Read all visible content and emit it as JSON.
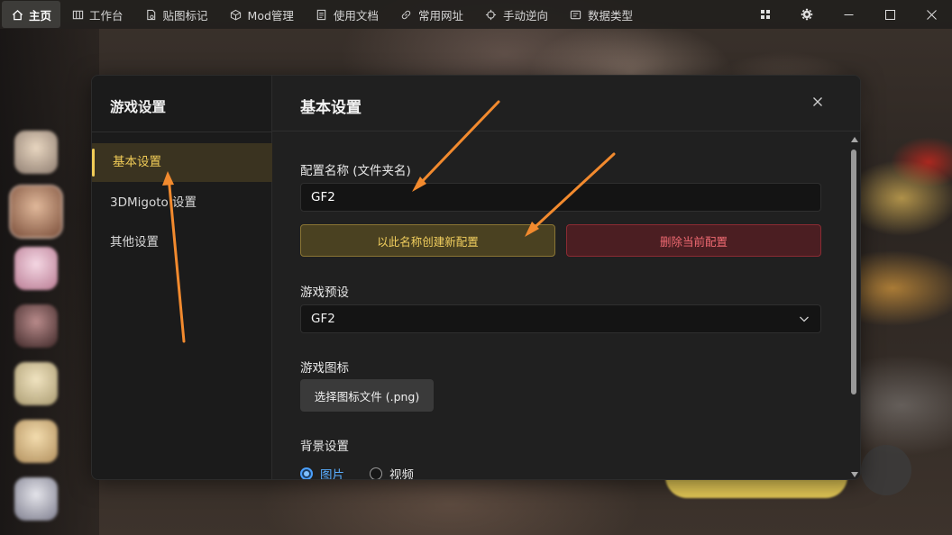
{
  "topbar": {
    "nav": [
      {
        "label": "主页",
        "icon": "home-icon",
        "active": true
      },
      {
        "label": "工作台",
        "icon": "workbench-icon"
      },
      {
        "label": "贴图标记",
        "icon": "texture-mark-icon"
      },
      {
        "label": "Mod管理",
        "icon": "cube-icon"
      },
      {
        "label": "使用文档",
        "icon": "document-icon"
      },
      {
        "label": "常用网址",
        "icon": "link-icon"
      },
      {
        "label": "手动逆向",
        "icon": "crosshair-icon"
      },
      {
        "label": "数据类型",
        "icon": "data-type-icon"
      }
    ],
    "window_buttons": [
      "grid-icon",
      "settings-icon",
      "minimize-icon",
      "maximize-icon",
      "close-icon"
    ]
  },
  "dialog": {
    "sidebar_title": "游戏设置",
    "sidebar_items": [
      {
        "label": "基本设置",
        "active": true
      },
      {
        "label": "3DMigoto 设置"
      },
      {
        "label": "其他设置"
      }
    ],
    "title": "基本设置",
    "config_name_label": "配置名称 (文件夹名)",
    "config_name_value": "GF2",
    "create_button": "以此名称创建新配置",
    "delete_button": "删除当前配置",
    "game_preset_label": "游戏预设",
    "game_preset_value": "GF2",
    "game_icon_label": "游戏图标",
    "choose_icon_button": "选择图标文件 (.png)",
    "background_label": "背景设置",
    "background_options": [
      {
        "label": "图片",
        "selected": true
      },
      {
        "label": "视频",
        "selected": false
      }
    ]
  },
  "colors": {
    "accent": "#f1cc57",
    "danger": "#f06a72",
    "radio_selected": "#4aa0ff",
    "annotation_arrow": "#f28a2e"
  }
}
